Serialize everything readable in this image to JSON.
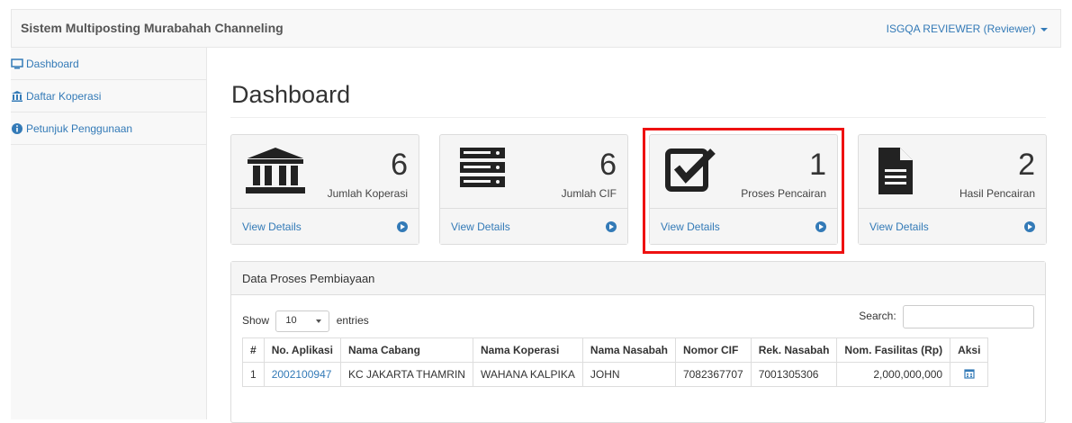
{
  "navbar": {
    "brand": "Sistem Multiposting Murabahah Channeling",
    "user": "ISGQA REVIEWER (Reviewer)"
  },
  "sidebar": {
    "items": [
      {
        "label": "Dashboard",
        "icon": "monitor-icon"
      },
      {
        "label": "Daftar Koperasi",
        "icon": "bank-icon"
      },
      {
        "label": "Petunjuk Penggunaan",
        "icon": "info-icon"
      }
    ]
  },
  "main": {
    "title": "Dashboard",
    "cards": [
      {
        "value": "6",
        "label": "Jumlah Koperasi",
        "icon": "bank-icon",
        "footer": "View Details"
      },
      {
        "value": "6",
        "label": "Jumlah CIF",
        "icon": "server-icon",
        "footer": "View Details"
      },
      {
        "value": "1",
        "label": "Proses Pencairan",
        "icon": "checkbox-icon",
        "footer": "View Details"
      },
      {
        "value": "2",
        "label": "Hasil Pencairan",
        "icon": "document-icon",
        "footer": "View Details"
      }
    ]
  },
  "panel": {
    "heading": "Data Proses Pembiayaan",
    "show_label": "Show",
    "entries_value": "10",
    "entries_label": "entries",
    "search_label": "Search:",
    "search_value": "",
    "columns": [
      "#",
      "No. Aplikasi",
      "Nama Cabang",
      "Nama Koperasi",
      "Nama Nasabah",
      "Nomor CIF",
      "Rek. Nasabah",
      "Nom. Fasilitas (Rp)",
      "Aksi"
    ],
    "rows": [
      {
        "no": "1",
        "aplikasi": "2002100947",
        "cabang": "KC JAKARTA THAMRIN",
        "koperasi": "WAHANA KALPIKA",
        "nasabah": "JOHN",
        "cif": "7082367707",
        "rekening": "7001305306",
        "fasilitas": "2,000,000,000",
        "aksi_icon": "calendar-icon"
      }
    ]
  },
  "colors": {
    "highlight": "#e11111",
    "link": "#337ab7"
  }
}
